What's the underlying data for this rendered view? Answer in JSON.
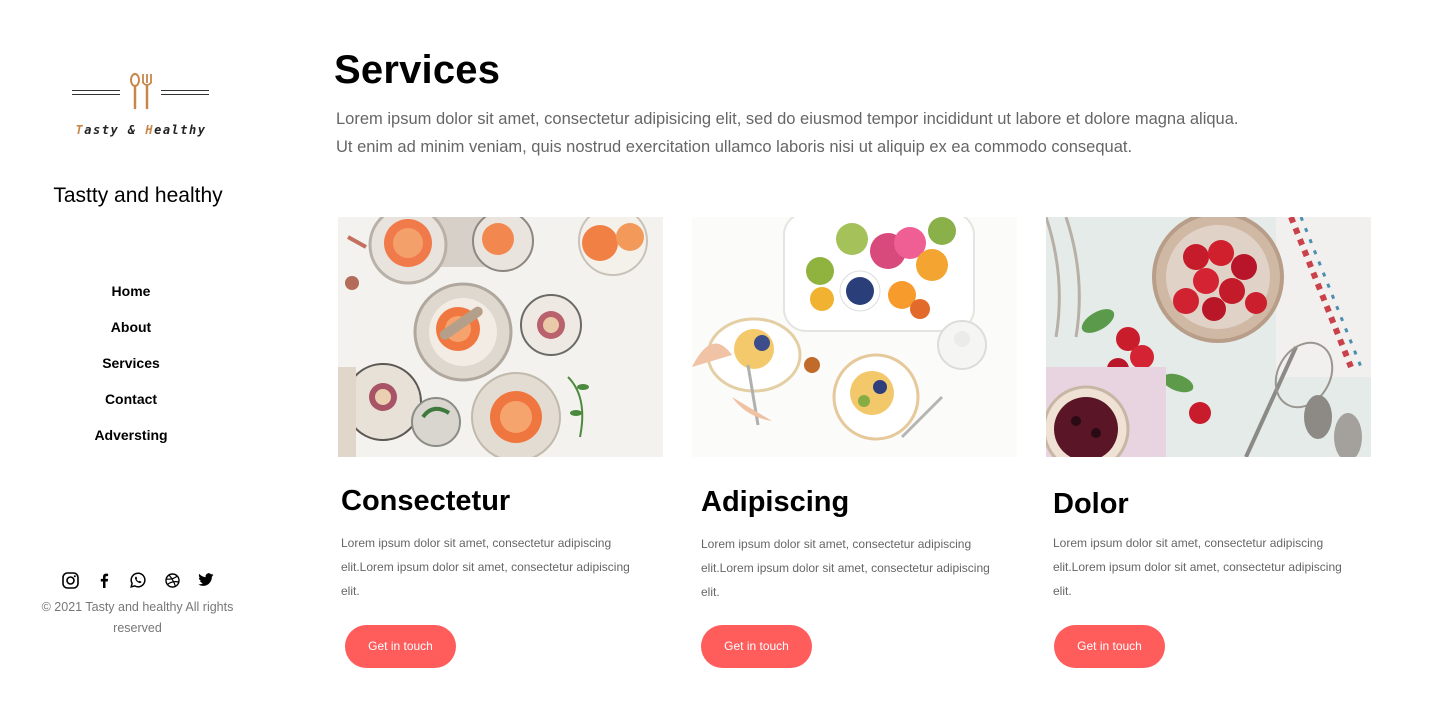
{
  "sidebar": {
    "logo_text_parts": [
      "T",
      "asty & ",
      "H",
      "ealthy"
    ],
    "site_name": "Tastty and healthy",
    "nav": [
      "Home",
      "About",
      "Services",
      "Contact",
      "Adversting"
    ],
    "social_icons": [
      "instagram-icon",
      "facebook-icon",
      "whatsapp-icon",
      "dribbble-icon",
      "twitter-icon"
    ],
    "copyright": "© 2021 Tasty and healthy All rights reserved"
  },
  "main": {
    "title": "Services",
    "intro_line1": "Lorem ipsum dolor sit amet, consectetur adipisicing elit, sed do eiusmod tempor incididunt ut labore et dolore magna aliqua.",
    "intro_line2": "Ut enim ad minim veniam, quis nostrud exercitation ullamco laboris nisi ut aliquip ex ea commodo consequat.",
    "cards": [
      {
        "title": "Consectetur",
        "text": "Lorem ipsum dolor sit amet, consectetur adipiscing elit.Lorem ipsum dolor sit amet, consectetur adipiscing elit.",
        "button": "Get in touch"
      },
      {
        "title": "Adipiscing",
        "text": "Lorem ipsum dolor sit amet, consectetur adipiscing elit.Lorem ipsum dolor sit amet, consectetur adipiscing elit.",
        "button": "Get in touch"
      },
      {
        "title": "Dolor",
        "text": "Lorem ipsum dolor sit amet, consectetur adipiscing elit.Lorem ipsum dolor sit amet, consectetur adipiscing elit.",
        "button": "Get in touch"
      }
    ]
  },
  "colors": {
    "accent": "#ff5c5c",
    "logo_gold": "#c8874a",
    "muted_text": "#666666"
  }
}
